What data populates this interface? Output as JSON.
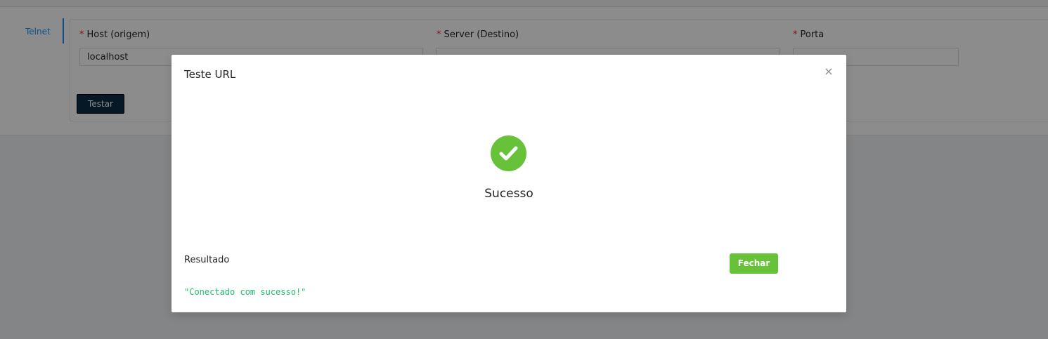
{
  "sidebar": {
    "active_tab": "Telnet"
  },
  "form": {
    "host": {
      "label": "Host (origem)",
      "value": "localhost",
      "required_mark": "*"
    },
    "server": {
      "label": "Server (Destino)",
      "required_mark": "*"
    },
    "port": {
      "label": "Porta",
      "required_mark": "*"
    },
    "test_button": "Testar"
  },
  "modal": {
    "title": "Teste URL",
    "close_glyph": "×",
    "status_text": "Sucesso",
    "result_label": "Resultado",
    "result_value": "\"Conectado com sucesso!\"",
    "close_button": "Fechar"
  },
  "colors": {
    "success": "#67c23a",
    "primary": "#1890ff",
    "result_text": "#19be6b",
    "test_button_bg": "#0b2a44"
  },
  "icons": {
    "status": "check-circle-icon",
    "close": "close-icon"
  }
}
